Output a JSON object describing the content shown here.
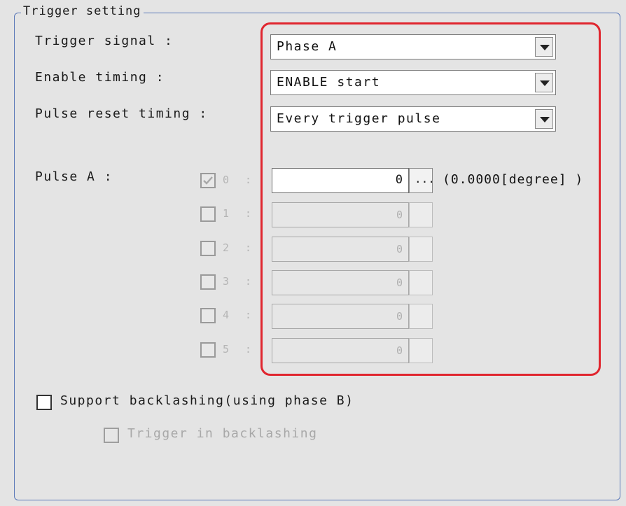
{
  "group": {
    "title": "Trigger setting"
  },
  "settings": [
    {
      "label": "Trigger signal :",
      "value": "Phase A"
    },
    {
      "label": "Enable timing :",
      "value": "ENABLE start"
    },
    {
      "label": "Pulse reset timing :",
      "value": "Every trigger pulse"
    }
  ],
  "pulse": {
    "label": "Pulse A :",
    "rows": [
      {
        "index": "0",
        "colon": ":",
        "value": "0",
        "checked": true,
        "enabled": true,
        "browse": "...",
        "unit": "(0.0000[degree] )"
      },
      {
        "index": "1",
        "colon": ":",
        "value": "0",
        "checked": false,
        "enabled": false
      },
      {
        "index": "2",
        "colon": ":",
        "value": "0",
        "checked": false,
        "enabled": false
      },
      {
        "index": "3",
        "colon": ":",
        "value": "0",
        "checked": false,
        "enabled": false
      },
      {
        "index": "4",
        "colon": ":",
        "value": "0",
        "checked": false,
        "enabled": false
      },
      {
        "index": "5",
        "colon": ":",
        "value": "0",
        "checked": false,
        "enabled": false
      }
    ]
  },
  "options": {
    "backlash_label": "Support backlashing(using phase B)",
    "trigger_backlash_label": "Trigger in backlashing"
  },
  "colors": {
    "highlight": "#e0262f",
    "group_border": "#5a78b8",
    "panel_bg": "#e4e4e4"
  }
}
